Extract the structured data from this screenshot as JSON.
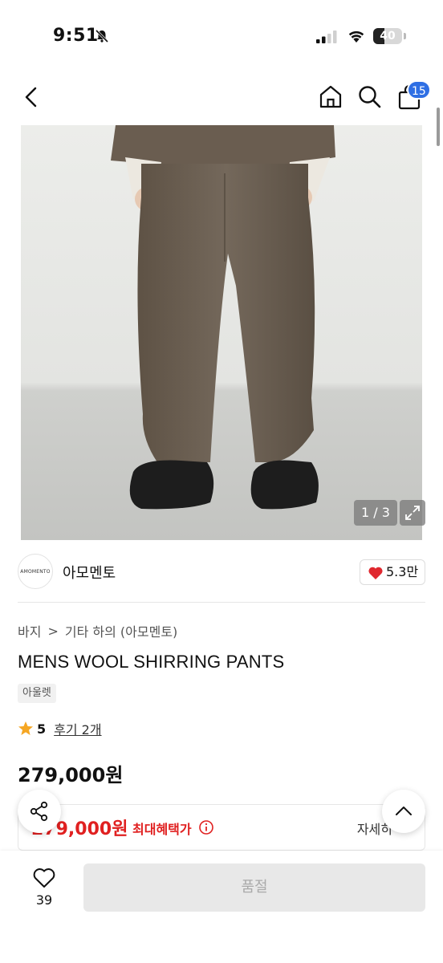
{
  "status_bar": {
    "time": "9:51",
    "battery": "40",
    "battery_level": 0.4,
    "icons": [
      "bell-slash-icon",
      "signal-icon",
      "wifi-icon",
      "battery-icon"
    ]
  },
  "header": {
    "icons": [
      "back-icon",
      "home-icon",
      "search-icon",
      "shopping-bag-icon"
    ],
    "cart_badge": "15"
  },
  "gallery": {
    "counter": "1 / 3",
    "expand_icon": "expand-icon"
  },
  "shop": {
    "logo_text": "AMOMENTO",
    "name": "아모멘토",
    "likes": "5.3만",
    "heart_color": "#e0282f"
  },
  "breadcrumb": {
    "category": "바지",
    "separator": ">",
    "subcategory": "기타 하의 (아모멘토)"
  },
  "product": {
    "title": "MENS WOOL SHIRRING PANTS",
    "tag": "아울렛",
    "rating": "5",
    "reviews": "후기 2개",
    "price": "279,000원",
    "star_color": "#f5a623"
  },
  "benefit": {
    "price": "279,000원",
    "label": "최대혜택가",
    "detail": "자세히",
    "accent": "#e02020"
  },
  "bottom_bar": {
    "wish_count": "39",
    "button_label": "품절"
  }
}
